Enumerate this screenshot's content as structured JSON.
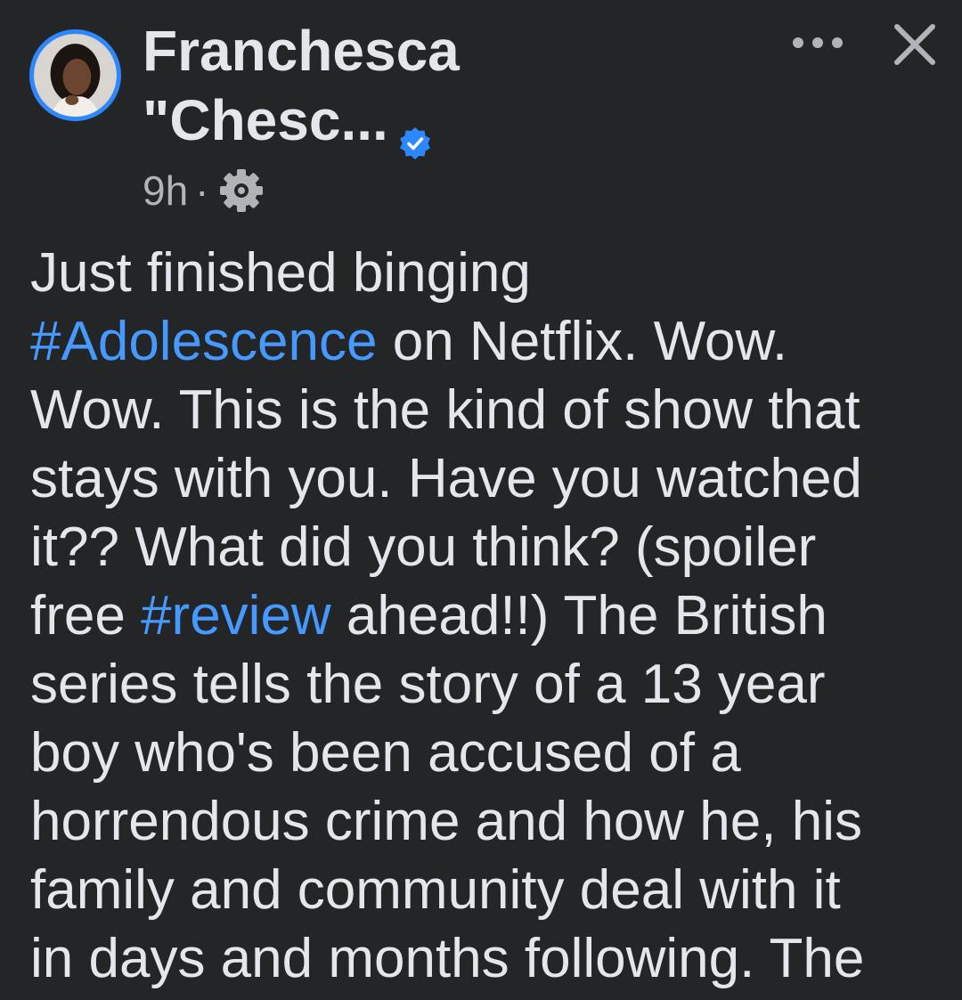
{
  "post": {
    "author": {
      "name_line1": "Franchesca",
      "name_line2": "\"Chesc...",
      "verified_icon": "verified-badge-icon",
      "avatar": "profile-photo"
    },
    "timestamp": "9h",
    "separator": "·",
    "audience_icon": "gear-icon",
    "actions": {
      "more_icon": "more-options-icon",
      "close_icon": "close-icon"
    },
    "body_lines": [
      {
        "parts": [
          {
            "text": "Just finished binging"
          }
        ]
      },
      {
        "parts": [
          {
            "text": "#Adolescence",
            "hashtag": true
          },
          {
            "text": " on Netflix. Wow."
          }
        ]
      },
      {
        "parts": [
          {
            "text": "Wow. This is the kind of show that"
          }
        ]
      },
      {
        "parts": [
          {
            "text": "stays with you.  Have you watched"
          }
        ]
      },
      {
        "parts": [
          {
            "text": "it?? What did you think?  (spoiler"
          }
        ]
      },
      {
        "parts": [
          {
            "text": "free "
          },
          {
            "text": "#review",
            "hashtag": true
          },
          {
            "text": " ahead!!) The British"
          }
        ]
      },
      {
        "parts": [
          {
            "text": "series tells the story of a 13 year"
          }
        ]
      },
      {
        "parts": [
          {
            "text": "boy who's been accused of a"
          }
        ]
      },
      {
        "parts": [
          {
            "text": "horrendous crime and how he, his"
          }
        ]
      },
      {
        "parts": [
          {
            "text": "family and community deal with it"
          }
        ]
      },
      {
        "parts": [
          {
            "text": "in days and months following. The"
          }
        ]
      }
    ]
  },
  "colors": {
    "background": "#242526",
    "text_primary": "#e4e6eb",
    "text_secondary": "#b0b3b8",
    "hashtag": "#4599ff",
    "accent_blue": "#2d88ff"
  }
}
